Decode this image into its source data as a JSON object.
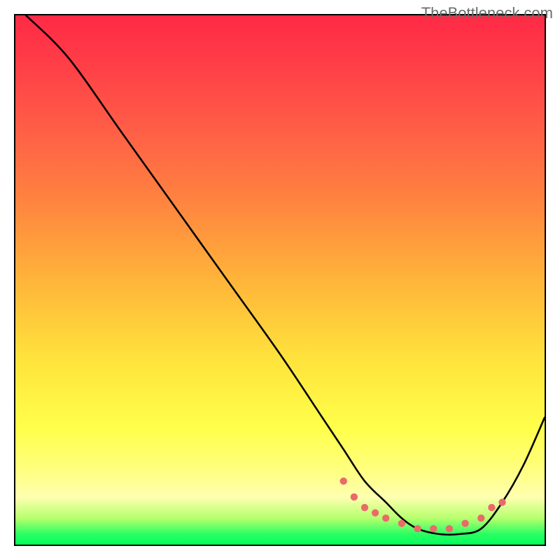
{
  "watermark": "TheBottleneck.com",
  "chart_data": {
    "type": "line",
    "title": "",
    "xlabel": "",
    "ylabel": "",
    "xlim": [
      0,
      100
    ],
    "ylim": [
      0,
      100
    ],
    "grid": false,
    "background_gradient": {
      "direction": "vertical",
      "stops": [
        {
          "pos": 0,
          "color": "#ff2a46"
        },
        {
          "pos": 50,
          "color": "#ffb43a"
        },
        {
          "pos": 78,
          "color": "#ffff4a"
        },
        {
          "pos": 100,
          "color": "#00ff5d"
        }
      ]
    },
    "series": [
      {
        "name": "bottleneck-curve",
        "stroke": "#000000",
        "x": [
          2,
          10,
          20,
          30,
          40,
          50,
          58,
          62,
          66,
          70,
          73,
          76,
          80,
          84,
          88,
          92,
          96,
          100
        ],
        "y": [
          100,
          92,
          78,
          64,
          50,
          36,
          24,
          18,
          12,
          8,
          5,
          3,
          2,
          2,
          3,
          8,
          15,
          24
        ]
      }
    ],
    "marker_points": {
      "name": "highlight-dots",
      "color": "#ea6a6a",
      "x": [
        62,
        64,
        66,
        68,
        70,
        73,
        76,
        79,
        82,
        85,
        88,
        90,
        92
      ],
      "y": [
        12,
        9,
        7,
        6,
        5,
        4,
        3,
        3,
        3,
        4,
        5,
        7,
        8
      ]
    }
  }
}
